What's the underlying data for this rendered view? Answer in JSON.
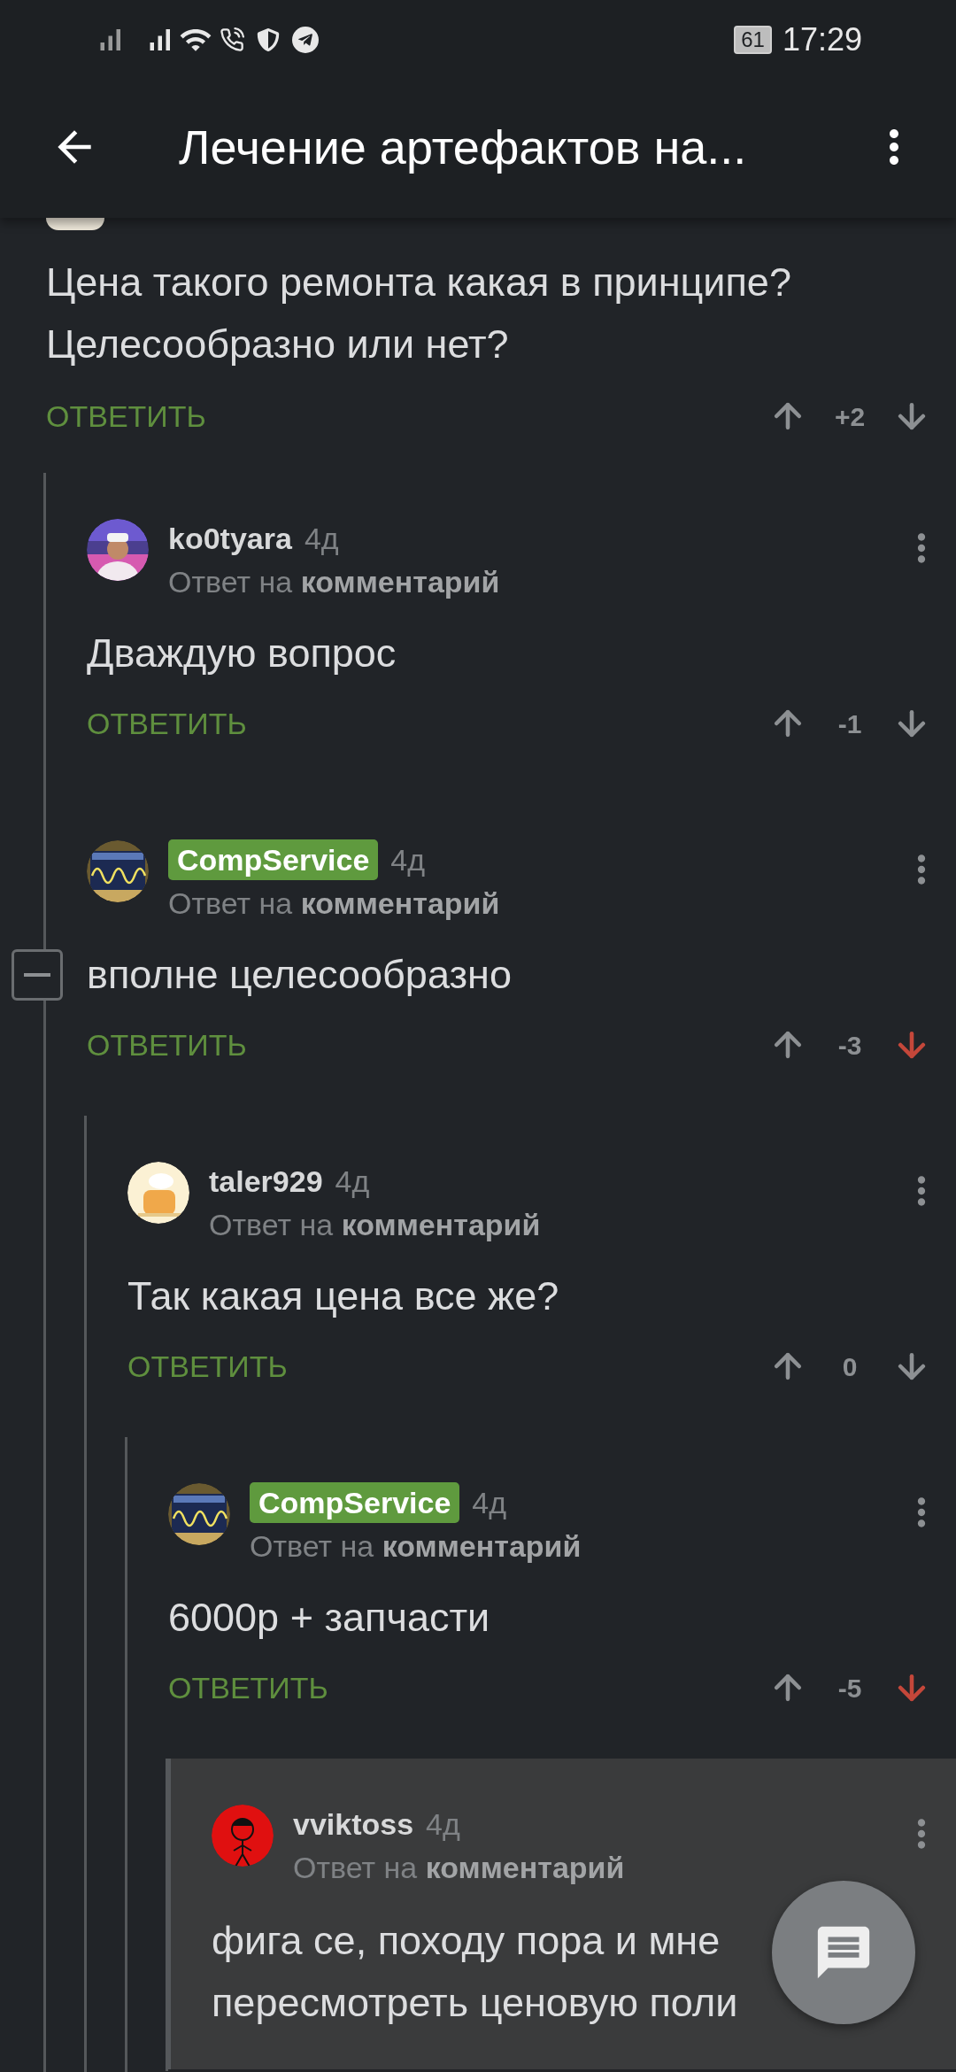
{
  "status_bar": {
    "battery": "61",
    "time": "17:29"
  },
  "app_bar": {
    "title": "Лечение артефактов на..."
  },
  "top_comment": {
    "text": "Цена такого ремонта какая в принципе? Целесообразно или нет?",
    "reply": "ОТВЕТИТЬ",
    "score": "+2",
    "downvoted": false,
    "children": [
      {
        "author": "ko0tyara",
        "badge": false,
        "time": "4д",
        "subtitle": "Ответ на **комментарий**",
        "text": "Дваждую вопрос",
        "reply": "ОТВЕТИТЬ",
        "score": "-1",
        "downvoted": false,
        "collapse_button": false,
        "highlighted": false
      },
      {
        "author": "CompService",
        "badge": true,
        "time": "4д",
        "subtitle": "Ответ на **комментарий**",
        "text": "вполне целесообразно",
        "reply": "ОТВЕТИТЬ",
        "score": "-3",
        "downvoted": true,
        "collapse_button": true,
        "highlighted": false,
        "children": [
          {
            "author": "taler929",
            "badge": false,
            "time": "4д",
            "subtitle": "Ответ на **комментарий**",
            "text": "Так какая цена все же?",
            "reply": "ОТВЕТИТЬ",
            "score": "0",
            "downvoted": false,
            "collapse_button": false,
            "highlighted": false,
            "children": [
              {
                "author": "CompService",
                "badge": true,
                "time": "4д",
                "subtitle": "Ответ на **комментарий**",
                "text": "6000р + запчасти",
                "reply": "ОТВЕТИТЬ",
                "score": "-5",
                "downvoted": true,
                "collapse_button": false,
                "highlighted": false,
                "children": [
                  {
                    "author": "vviktoss",
                    "badge": false,
                    "time": "4д",
                    "subtitle": "Ответ на **комментарий**",
                    "text_lines": [
                      "фига се, походу пора и мне",
                      "пересмотреть ценовую поли"
                    ],
                    "collapse_button": false,
                    "highlighted": true
                  }
                ]
              }
            ]
          }
        ]
      }
    ]
  }
}
